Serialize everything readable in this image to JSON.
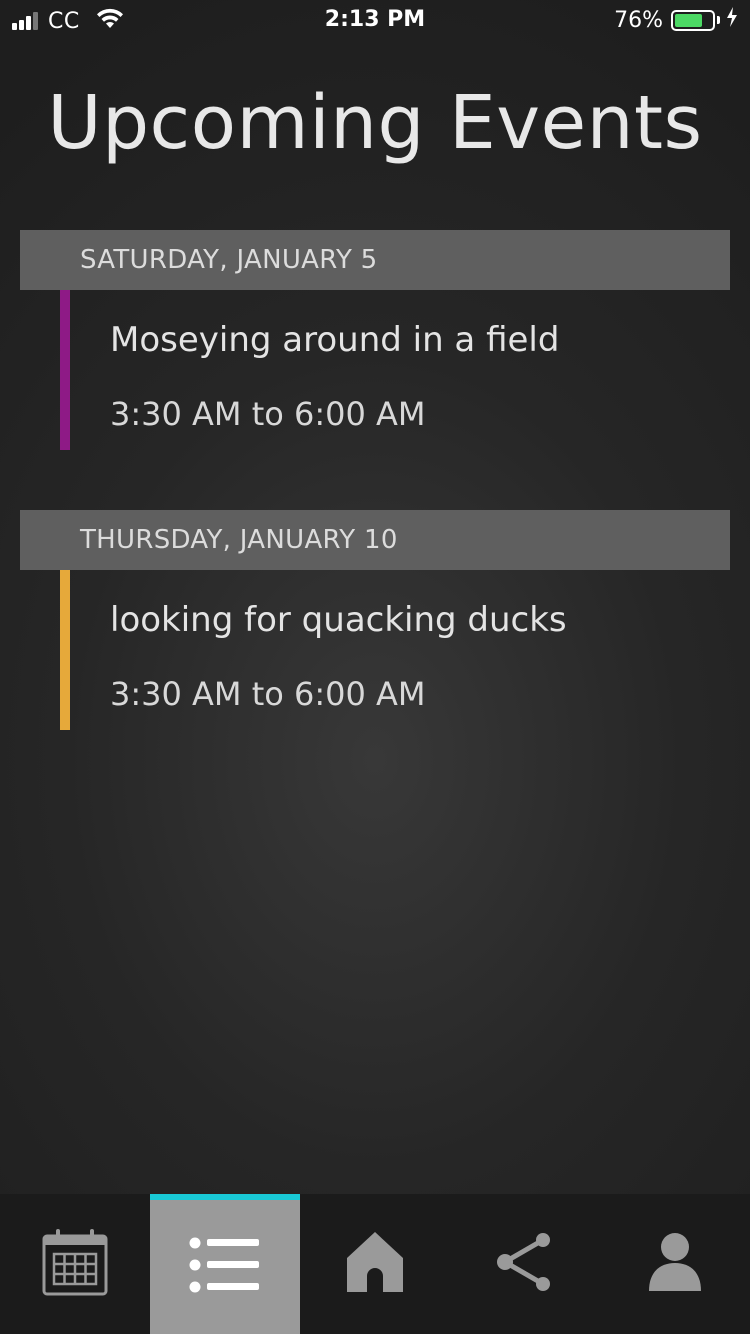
{
  "status_bar": {
    "carrier": "CC",
    "time": "2:13 PM",
    "battery_percent": "76%",
    "battery_level": 0.76,
    "signal_bars_active": 3,
    "signal_bars_total": 4
  },
  "page": {
    "title": "Upcoming Events"
  },
  "events": [
    {
      "date_header": "SATURDAY, JANUARY 5",
      "title": "Moseying around in a field",
      "time_range": "3:30 AM to 6:00 AM",
      "color": "#8e1a86"
    },
    {
      "date_header": "THURSDAY, JANUARY 10",
      "title": "looking for quacking ducks",
      "time_range": "3:30 AM to 6:00 AM",
      "color": "#e6a93a"
    }
  ],
  "tab_bar": {
    "tabs": [
      {
        "icon": "calendar-icon",
        "active": false
      },
      {
        "icon": "list-icon",
        "active": true
      },
      {
        "icon": "home-icon",
        "active": false
      },
      {
        "icon": "share-icon",
        "active": false
      },
      {
        "icon": "user-icon",
        "active": false
      }
    ],
    "active_indicator_color": "#19c9d6"
  },
  "colors": {
    "background": "#262626",
    "date_header_bg": "#5f5f5f",
    "tab_bar_bg": "#1b1b1b",
    "active_tab_bg": "#9a9a9a",
    "icon_color": "#9a9a9a"
  }
}
